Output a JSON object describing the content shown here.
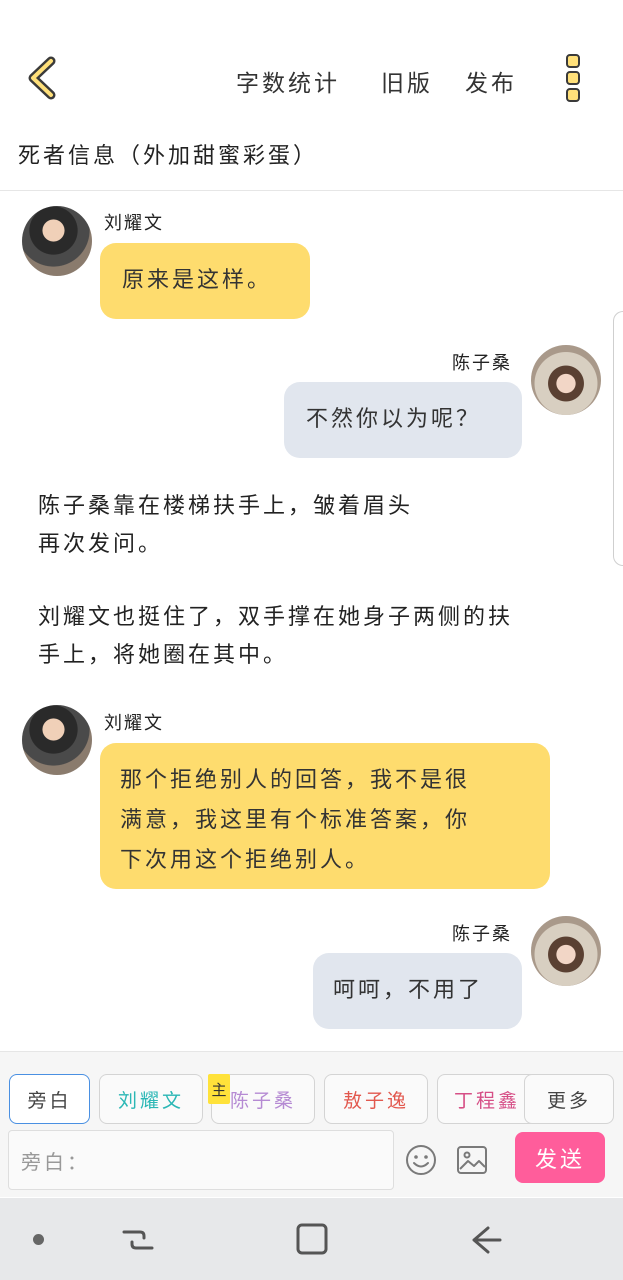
{
  "header": {
    "actions": [
      "字数统计",
      "旧版",
      "发布"
    ],
    "title": "死者信息（外加甜蜜彩蛋）"
  },
  "messages": [
    {
      "speaker": "刘耀文",
      "side": "left",
      "text": "原来是这样。"
    },
    {
      "speaker": "陈子桑",
      "side": "right",
      "text": "不然你以为呢？"
    },
    {
      "narration": [
        "陈子桑靠在楼梯扶手上，皱着眉头",
        "再次发问。"
      ]
    },
    {
      "narration": [
        "刘耀文也挺住了，双手撑在她身子两侧的扶",
        "手上，将她圈在其中。"
      ]
    },
    {
      "speaker": "刘耀文",
      "side": "left",
      "text": [
        "那个拒绝别人的回答，我不是很",
        "满意，我这里有个标准答案，你",
        "下次用这个拒绝别人。"
      ]
    },
    {
      "speaker": "陈子桑",
      "side": "right",
      "text": "呵呵，不用了"
    }
  ],
  "input": {
    "roles": [
      {
        "label": "旁白",
        "color": "#444444"
      },
      {
        "label": "刘耀文",
        "color": "#2bb7b5"
      },
      {
        "label": "陈子桑",
        "color": "#b58ad3"
      },
      {
        "label": "敖子逸",
        "color": "#e2584e"
      },
      {
        "label": "丁程鑫",
        "color": "#d64f86"
      },
      {
        "label": "更多",
        "color": "#444444"
      }
    ],
    "main_tag": "主",
    "placeholder": "旁白：",
    "send_label": "发送"
  },
  "icons": {
    "back": "chevron-left-icon",
    "more": "more-vertical-icon",
    "emoji": "emoji-icon",
    "image": "image-icon"
  },
  "colors": {
    "bubble_left": "#fedc6e",
    "bubble_right": "#e1e6ee",
    "send": "#ff5d9b",
    "active_chip_border": "#4a90e2"
  }
}
